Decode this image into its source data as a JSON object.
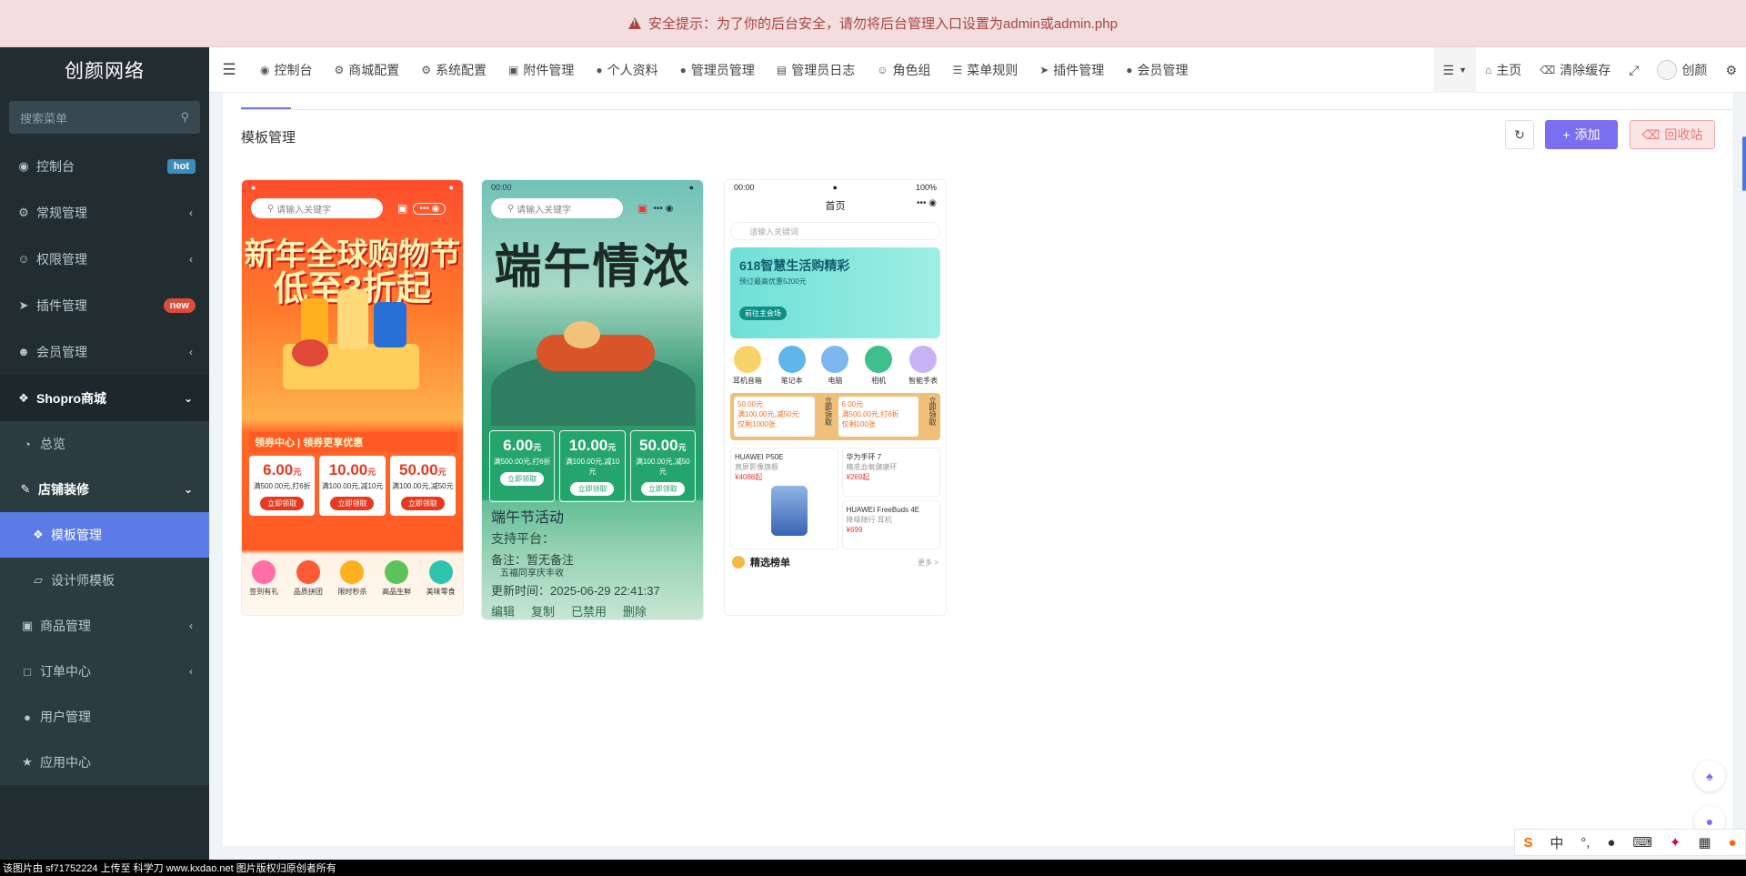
{
  "alert": {
    "text": "安全提示：为了你的后台安全，请勿将后台管理入口设置为admin或admin.php"
  },
  "sidebar": {
    "logo": "创颜网络",
    "search_placeholder": "搜索菜单",
    "items": [
      {
        "label": "控制台",
        "icon": "dashboard-icon",
        "badge": "hot",
        "badge_color": "#3c8dbc"
      },
      {
        "label": "常规管理",
        "icon": "cogs-icon"
      },
      {
        "label": "权限管理",
        "icon": "group-icon"
      },
      {
        "label": "插件管理",
        "icon": "rocket-icon",
        "badge": "new",
        "badge_color": "#dd4b39"
      },
      {
        "label": "会员管理",
        "icon": "user-circle-icon"
      },
      {
        "label": "Shopro商城",
        "icon": "dropbox-icon"
      },
      {
        "label": "总览",
        "icon": "pie-icon"
      },
      {
        "label": "店铺装修",
        "icon": "brush-icon"
      },
      {
        "label": "模板管理",
        "icon": "cubes-icon"
      },
      {
        "label": "设计师模板",
        "icon": "cube-icon"
      },
      {
        "label": "商品管理",
        "icon": "archive-icon"
      },
      {
        "label": "订单中心",
        "icon": "file-icon"
      },
      {
        "label": "用户管理",
        "icon": "user-icon"
      },
      {
        "label": "应用中心",
        "icon": "star-icon"
      }
    ]
  },
  "navbar": {
    "items": [
      "控制台",
      "商城配置",
      "系统配置",
      "附件管理",
      "个人资料",
      "管理员管理",
      "管理员日志",
      "角色组",
      "菜单规则",
      "插件管理",
      "会员管理"
    ],
    "right": {
      "home": "主页",
      "clear_cache": "清除缓存",
      "user": "创颜"
    }
  },
  "page": {
    "title": "模板管理",
    "add_label": "添加",
    "trash_label": "回收站"
  },
  "cards": {
    "c1": {
      "search": "请输入关键字",
      "headline1": "新年全球购物节",
      "headline2": "低至3折起",
      "strip": "领券中心 | 领券更享优惠",
      "coupons": [
        {
          "value": "6.00",
          "unit": "元",
          "desc": "满500.00元,打6折",
          "btn": "立即领取"
        },
        {
          "value": "10.00",
          "unit": "元",
          "desc": "满100.00元,减10元",
          "btn": "立即领取"
        },
        {
          "value": "50.00",
          "unit": "元",
          "desc": "满100.00元,减50元",
          "btn": "立即领取"
        }
      ],
      "icons": [
        "签到有礼",
        "品质拼团",
        "限时秒杀",
        "高品生鲜",
        "美味零食"
      ]
    },
    "c2": {
      "time": "00:00",
      "search": "请输入关键字",
      "headline": "端午情浓",
      "coupons": [
        {
          "value": "6.00",
          "unit": "元",
          "desc": "满500.00元,打6折",
          "btn": "立即领取"
        },
        {
          "value": "10.00",
          "unit": "元",
          "desc": "满100.00元,减10元",
          "btn": "立即领取"
        },
        {
          "value": "50.00",
          "unit": "元",
          "desc": "满100.00元,减50元",
          "btn": "立即领取"
        }
      ],
      "overlay": {
        "name": "端午节活动",
        "platform": "支持平台：",
        "remark": "备注：暂无备注",
        "updated": "更新时间：2025-06-29 22:41:37",
        "actions": [
          "编辑",
          "复制",
          "已禁用",
          "删除"
        ],
        "ticket": "五福同享庆丰收"
      }
    },
    "c3": {
      "time": "00:00",
      "battery": "100%",
      "title": "首页",
      "search": "请输入关键词",
      "banner_title": "618智慧生活购精彩",
      "banner_sub": "预订最高优惠5200元",
      "banner_btn": "前往主会场",
      "cats": [
        "耳机音箱",
        "笔记本",
        "电脑",
        "相机",
        "智能手表"
      ],
      "coupons": [
        {
          "l1": "50.00元",
          "l2": "满100.00元,减50元",
          "l3": "仅剩1000张",
          "btn": "立即领取"
        },
        {
          "l1": "6.00元",
          "l2": "满500.00元,打6折",
          "l3": "仅剩100张",
          "btn": "立即领取"
        }
      ],
      "products": [
        {
          "name": "HUAWEI P50E",
          "sub": "直屏影像旗舰",
          "price": "¥4088起"
        },
        {
          "name": "华为手环 7",
          "sub": "精准血氧健康环",
          "price": "¥269起"
        },
        {
          "name": "HUAWEI FreeBuds 4E",
          "sub": "降噪随行 耳机",
          "price": "¥699"
        }
      ],
      "rank": "精选榜单",
      "more": "更多 >"
    }
  },
  "footer": {
    "text": "该图片由 sf71752224 上传至 科学刀 www.kxdao.net 图片版权归原创者所有"
  },
  "colors": {
    "accent": "#7a6ff0",
    "sidebar": "#222d32",
    "active": "#5b7be6",
    "alert_bg": "#f2dede"
  }
}
